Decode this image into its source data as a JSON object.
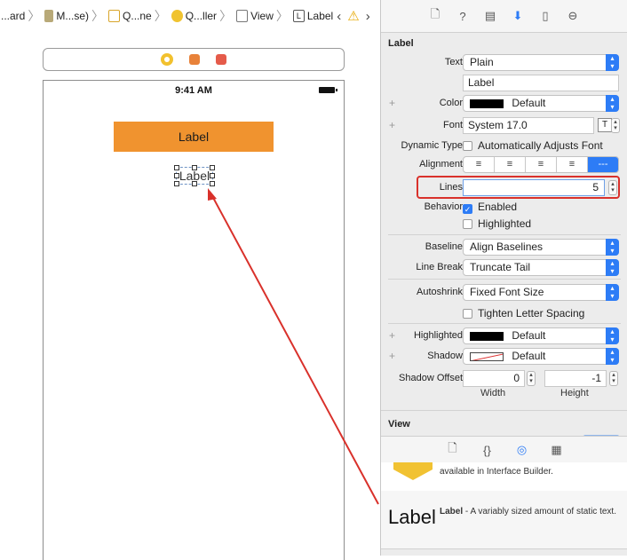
{
  "breadcrumb": {
    "items": [
      "...ard",
      "M...se)",
      "Q...ne",
      "Q...ller",
      "View",
      "Label"
    ],
    "warning_icon": "warning-icon",
    "back_arrow": "‹",
    "forward_arrow": "›"
  },
  "canvas": {
    "status_time": "9:41 AM",
    "orange_label_text": "Label",
    "selected_label_text": "Label",
    "orange_color": "#f0932f"
  },
  "inspector": {
    "section_title": "Label",
    "text": {
      "label": "Text",
      "value": "Plain"
    },
    "text_field_value": "Label",
    "color": {
      "label": "Color",
      "value": "Default"
    },
    "font": {
      "label": "Font",
      "value": "System 17.0"
    },
    "dynamic_type": {
      "label": "Dynamic Type",
      "checkbox_label": "Automatically Adjusts Font"
    },
    "alignment": {
      "label": "Alignment",
      "options": [
        "≡",
        "≡",
        "≡",
        "≡",
        "---"
      ]
    },
    "lines": {
      "label": "Lines",
      "value": "5"
    },
    "behavior": {
      "label": "Behavior",
      "enabled_label": "Enabled",
      "highlighted_label": "Highlighted"
    },
    "baseline": {
      "label": "Baseline",
      "value": "Align Baselines"
    },
    "line_break": {
      "label": "Line Break",
      "value": "Truncate Tail"
    },
    "autoshrink": {
      "label": "Autoshrink",
      "value": "Fixed Font Size"
    },
    "tighten_label": "Tighten Letter Spacing",
    "highlighted": {
      "label": "Highlighted",
      "value": "Default"
    },
    "shadow": {
      "label": "Shadow",
      "value": "Default"
    },
    "shadow_offset": {
      "label": "Shadow Offset",
      "width_value": "0",
      "height_value": "-1",
      "width_label": "Width",
      "height_label": "Height"
    },
    "view_section_title": "View",
    "accent_color": "#2d7cf6"
  },
  "library": {
    "row1_text": "available in Interface Builder.",
    "big_label": "Label",
    "desc_bold": "Label",
    "desc_text": " - A variably sized amount of static text."
  }
}
